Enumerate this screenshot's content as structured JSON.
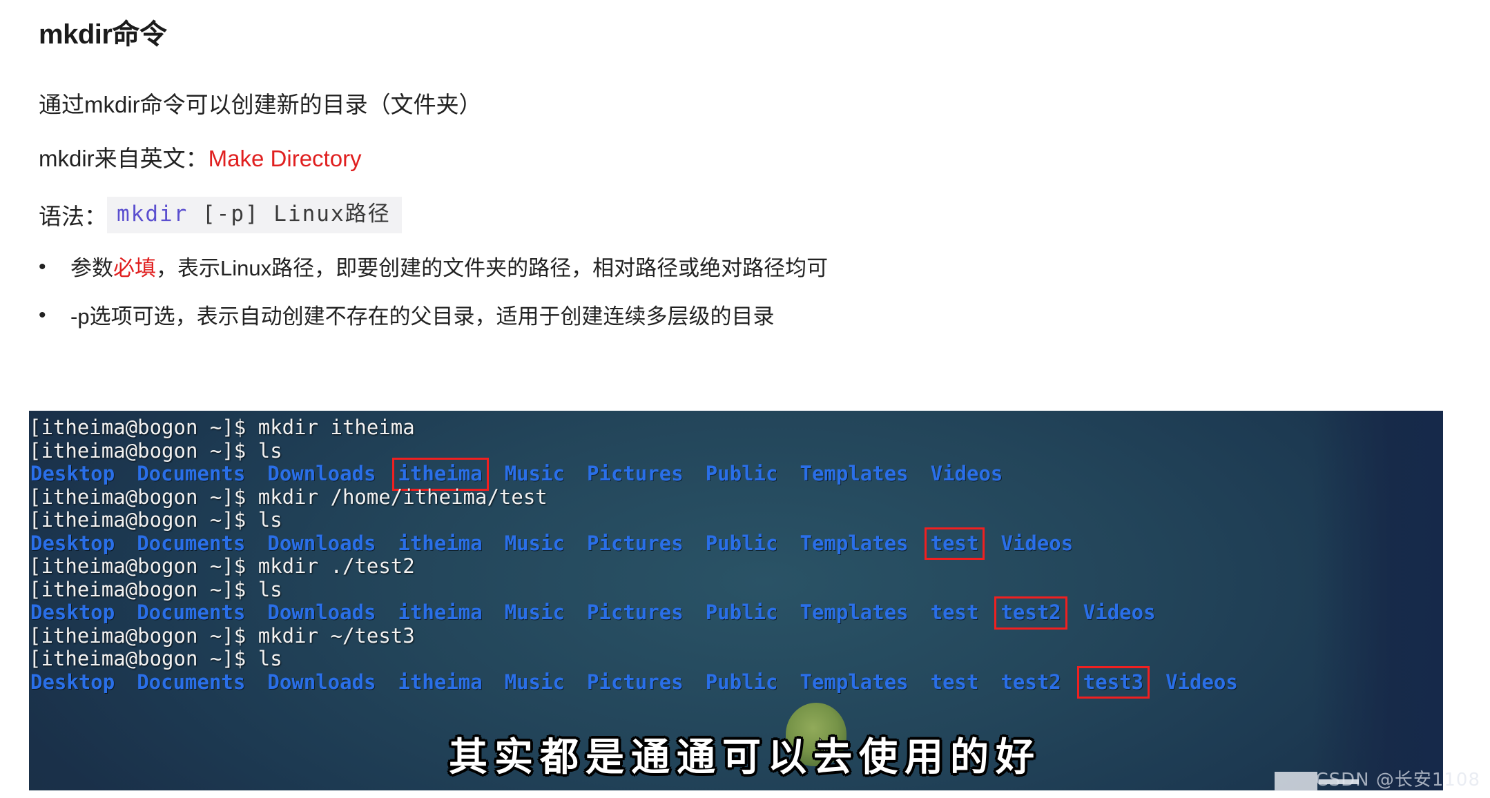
{
  "doc": {
    "title": "mkdir命令",
    "intro": "通过mkdir命令可以创建新的目录（文件夹）",
    "origin_prefix": "mkdir来自英文：",
    "origin_value": "Make Directory",
    "syntax_label": "语法：",
    "syntax_cmd": "mkdir",
    "syntax_rest": " [-p] Linux路径",
    "bullet_dot": "•",
    "bullets": [
      {
        "pre": "参数",
        "emph": "必填",
        "post": "，表示Linux路径，即要创建的文件夹的路径，相对路径或绝对路径均可"
      },
      {
        "pre": "",
        "emph": "",
        "post": "-p选项可选，表示自动创建不存在的父目录，适用于创建连续多层级的目录"
      }
    ]
  },
  "terminal": {
    "prompt": "[itheima@bogon ~]$ ",
    "lines": [
      {
        "type": "cmd",
        "text": "[itheima@bogon ~]$ mkdir itheima"
      },
      {
        "type": "cmd",
        "text": "[itheima@bogon ~]$ ls"
      },
      {
        "type": "ls",
        "items": [
          {
            "name": "Desktop",
            "highlight": false
          },
          {
            "name": "Documents",
            "highlight": false
          },
          {
            "name": "Downloads",
            "highlight": false
          },
          {
            "name": "itheima",
            "highlight": true
          },
          {
            "name": "Music",
            "highlight": false
          },
          {
            "name": "Pictures",
            "highlight": false
          },
          {
            "name": "Public",
            "highlight": false
          },
          {
            "name": "Templates",
            "highlight": false
          },
          {
            "name": "Videos",
            "highlight": false
          }
        ]
      },
      {
        "type": "cmd",
        "text": "[itheima@bogon ~]$ mkdir /home/itheima/test"
      },
      {
        "type": "cmd",
        "text": "[itheima@bogon ~]$ ls"
      },
      {
        "type": "ls",
        "items": [
          {
            "name": "Desktop",
            "highlight": false
          },
          {
            "name": "Documents",
            "highlight": false
          },
          {
            "name": "Downloads",
            "highlight": false
          },
          {
            "name": "itheima",
            "highlight": false
          },
          {
            "name": "Music",
            "highlight": false
          },
          {
            "name": "Pictures",
            "highlight": false
          },
          {
            "name": "Public",
            "highlight": false
          },
          {
            "name": "Templates",
            "highlight": false
          },
          {
            "name": "test",
            "highlight": true
          },
          {
            "name": "Videos",
            "highlight": false
          }
        ]
      },
      {
        "type": "cmd",
        "text": "[itheima@bogon ~]$ mkdir ./test2"
      },
      {
        "type": "cmd",
        "text": "[itheima@bogon ~]$ ls"
      },
      {
        "type": "ls",
        "items": [
          {
            "name": "Desktop",
            "highlight": false
          },
          {
            "name": "Documents",
            "highlight": false
          },
          {
            "name": "Downloads",
            "highlight": false
          },
          {
            "name": "itheima",
            "highlight": false
          },
          {
            "name": "Music",
            "highlight": false
          },
          {
            "name": "Pictures",
            "highlight": false
          },
          {
            "name": "Public",
            "highlight": false
          },
          {
            "name": "Templates",
            "highlight": false
          },
          {
            "name": "test",
            "highlight": false
          },
          {
            "name": "test2",
            "highlight": true
          },
          {
            "name": "Videos",
            "highlight": false
          }
        ]
      },
      {
        "type": "cmd",
        "text": "[itheima@bogon ~]$ mkdir ~/test3"
      },
      {
        "type": "cmd",
        "text": "[itheima@bogon ~]$ ls"
      },
      {
        "type": "ls",
        "items": [
          {
            "name": "Desktop",
            "highlight": false
          },
          {
            "name": "Documents",
            "highlight": false
          },
          {
            "name": "Downloads",
            "highlight": false
          },
          {
            "name": "itheima",
            "highlight": false
          },
          {
            "name": "Music",
            "highlight": false
          },
          {
            "name": "Pictures",
            "highlight": false
          },
          {
            "name": "Public",
            "highlight": false
          },
          {
            "name": "Templates",
            "highlight": false
          },
          {
            "name": "test",
            "highlight": false
          },
          {
            "name": "test2",
            "highlight": false
          },
          {
            "name": "test3",
            "highlight": true
          },
          {
            "name": "Videos",
            "highlight": false
          }
        ]
      }
    ]
  },
  "overlay": {
    "subtitle": "其实都是通通可以去使用的好",
    "watermark": "CSDN @长安1108"
  },
  "colors": {
    "highlight_box": "#f02020",
    "dir_blue": "#2a6fe8",
    "prompt_white": "#f2f2f2",
    "accent_red": "#e02020",
    "syntax_purple": "#5b4fcf",
    "terminal_bg": "#265366"
  }
}
